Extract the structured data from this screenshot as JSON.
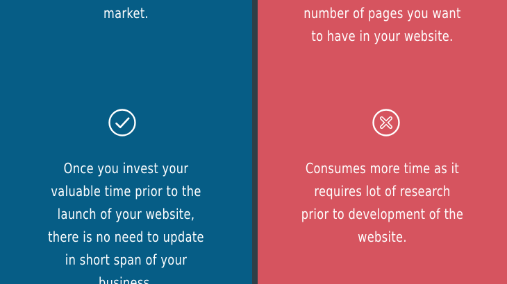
{
  "left_panel": {
    "top_text": "market.",
    "icon": "checkmark-circle-icon",
    "body_text": "Once you invest your\nvaluable time prior to the\nlaunch of your website,\nthere is no need to update\nin short span of your\nbusiness."
  },
  "right_panel": {
    "top_text": "number of pages you want\nto have in your website.",
    "icon": "x-circle-icon",
    "body_text": "Consumes more time as it\nrequires lot of research\nprior to development of the\nwebsite."
  },
  "colors": {
    "left_background": "#065d86",
    "right_background": "#d6545f",
    "divider": "#2f3f47",
    "text": "#ffffff"
  }
}
